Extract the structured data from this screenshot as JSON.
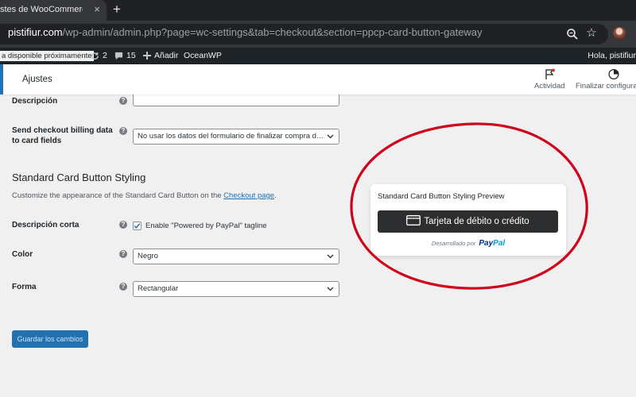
{
  "browser": {
    "tab_title": "stes de WooCommerce ‹",
    "close_glyph": "×",
    "new_tab_glyph": "+",
    "url_host": "pistifiur.com",
    "url_path": "/wp-admin/admin.php?page=wc-settings&tab=checkout&section=ppcp-card-button-gateway",
    "star_glyph": "☆"
  },
  "adminbar": {
    "update_notice": "a disponible próximamente",
    "updates_count": "2",
    "comments_count": "15",
    "add_new": "Añadir",
    "theme": "OceanWP",
    "greeting": "Hola, pistifiur"
  },
  "header": {
    "title": "Ajustes",
    "activity": "Actividad",
    "finish_setup": "Finalizar configuración"
  },
  "form": {
    "description_label": "Descripción",
    "billing_label": "Send checkout billing data to card fields",
    "billing_value": "No usar los datos del formulario de finalizar compra de facturación",
    "section_title": "Standard Card Button Styling",
    "section_desc_prefix": "Customize the appearance of the Standard Card Button on the ",
    "section_desc_link": "Checkout page",
    "section_desc_suffix": ".",
    "short_desc_label": "Descripción corta",
    "tagline_checkbox": "Enable \"Powered by PayPal\" tagline",
    "tagline_checked": true,
    "color_label": "Color",
    "color_value": "Negro",
    "shape_label": "Forma",
    "shape_value": "Rectangular",
    "save_button": "Guardar los cambios",
    "help_glyph": "?"
  },
  "preview": {
    "title": "Standard Card Button Styling Preview",
    "button_label": "Tarjeta de débito o crédito",
    "powered_by": "Desarrollado por",
    "paypal_pay": "Pay",
    "paypal_pal": "Pal"
  },
  "colors": {
    "admin_bar": "#1d2327",
    "wp_blue": "#2271b1",
    "card_button": "#2c2e2f",
    "annotation": "#d0021b"
  },
  "icons": [
    "close-icon",
    "plus-icon",
    "zoom-icon",
    "star-icon",
    "refresh-icon",
    "comment-icon",
    "plus-icon",
    "flag-icon",
    "progress-icon",
    "help-icon",
    "check-icon",
    "chevron-down-icon",
    "credit-card-icon"
  ]
}
